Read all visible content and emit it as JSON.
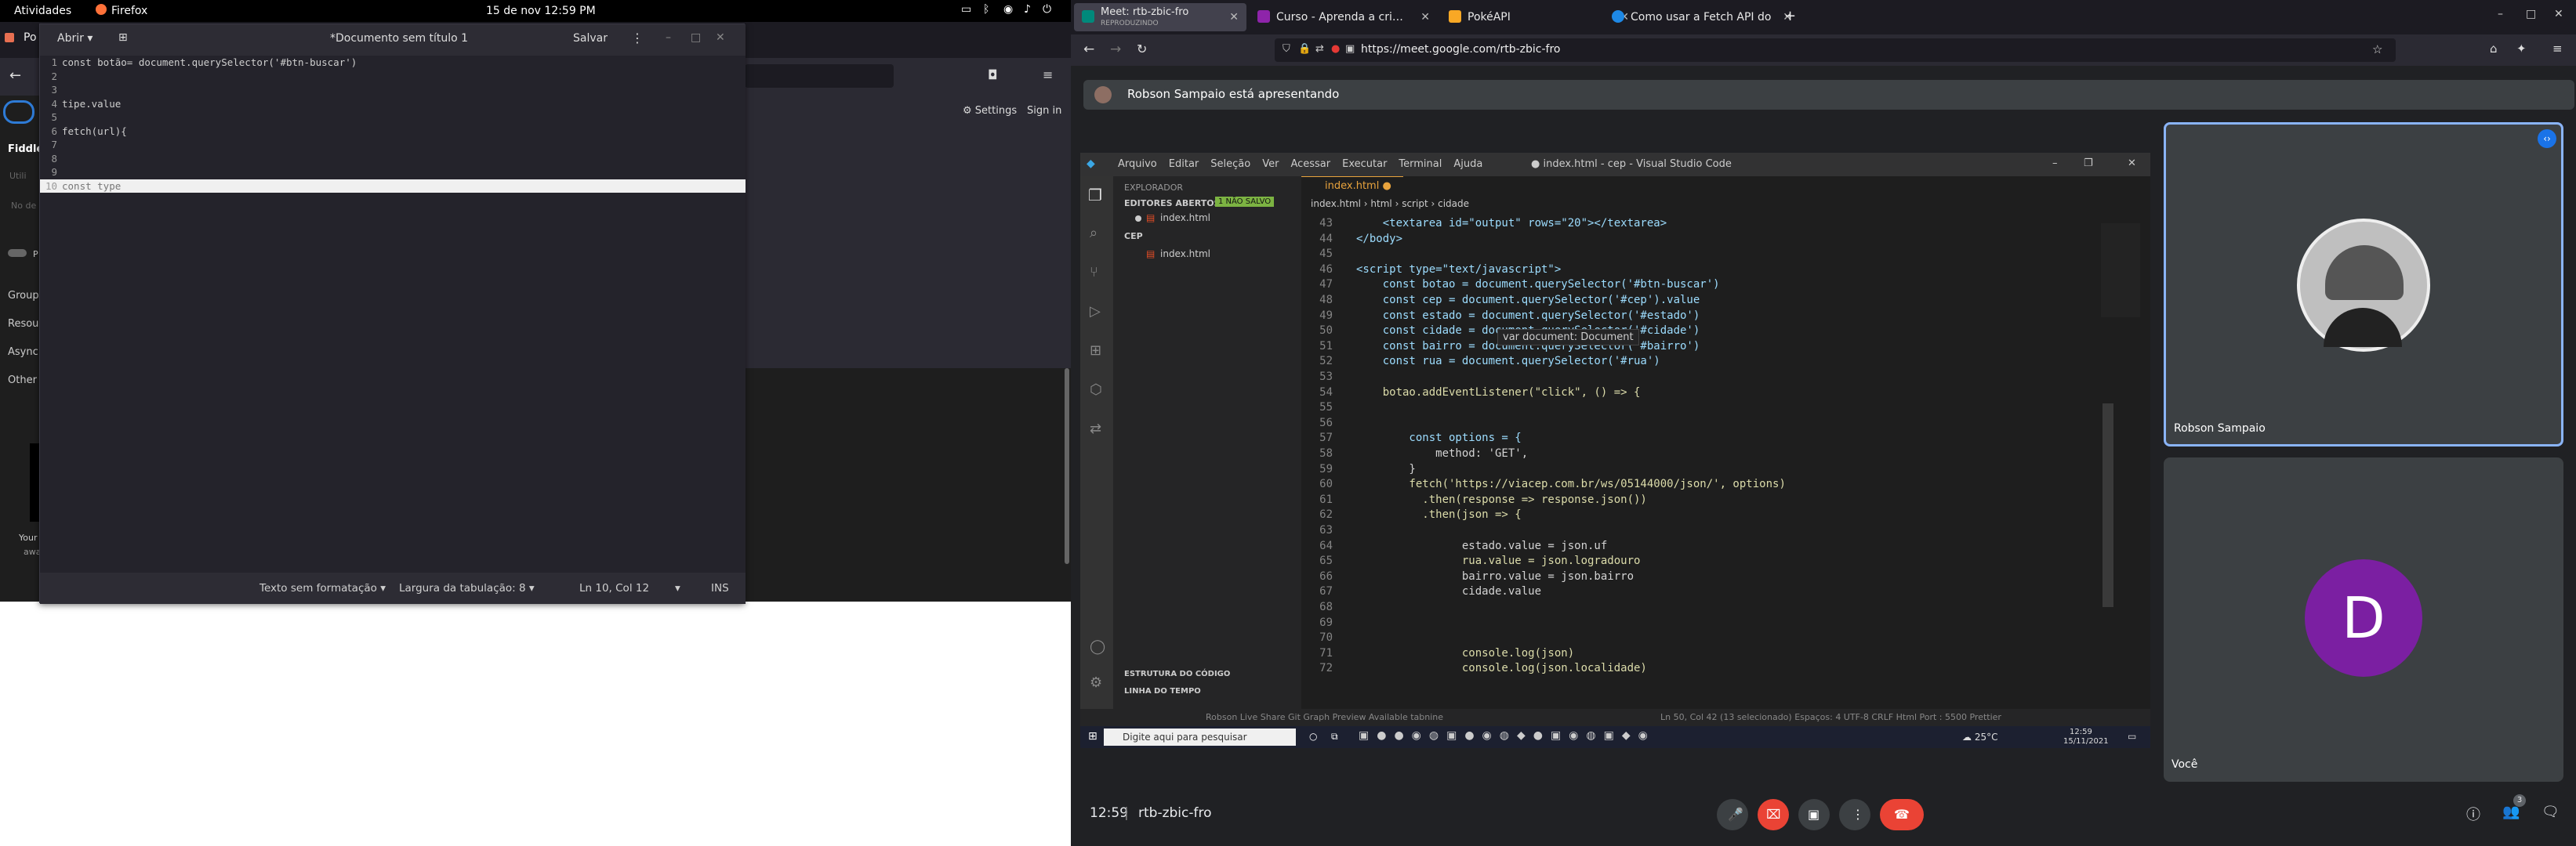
{
  "gnome": {
    "activities": "Atividades",
    "app": "Firefox",
    "datetime": "15 de nov  12:59 PM"
  },
  "bg_browser": {
    "tab": "Po",
    "settings": "Settings",
    "signin": "Sign in",
    "fiddle": "Fiddle",
    "items": [
      "Group",
      "Resou",
      "Async",
      "Other"
    ],
    "util": "Utili",
    "nao": "No de",
    "p": "P",
    "your": "Your",
    "awa": "awa"
  },
  "gedit": {
    "open_label": "Abrir",
    "title": "*Documento sem título 1",
    "save_label": "Salvar",
    "lines": [
      {
        "n": "1",
        "text": "const botão= document.querySelector('#btn-buscar')"
      },
      {
        "n": "2",
        "text": ""
      },
      {
        "n": "3",
        "text": ""
      },
      {
        "n": "4",
        "text": "tipe.value"
      },
      {
        "n": "5",
        "text": ""
      },
      {
        "n": "6",
        "text": "fetch(url){"
      },
      {
        "n": "7",
        "text": ""
      },
      {
        "n": "8",
        "text": ""
      },
      {
        "n": "9",
        "text": ""
      },
      {
        "n": "10",
        "text": "const type"
      }
    ],
    "status": {
      "format": "Texto sem formatação",
      "tab_width": "Largura da tabulação: 8",
      "position": "Ln 10, Col 12",
      "mode": "INS"
    }
  },
  "firefox": {
    "tabs": [
      {
        "label": "Meet: rtb-zbic-fro",
        "sub": "REPRODUZINDO",
        "color": "#00897b"
      },
      {
        "label": "Curso - Aprenda a criar u",
        "color": "#8e24aa"
      },
      {
        "label": "PokéAPI",
        "color": "#f9a825"
      },
      {
        "label": "Como usar a Fetch API do",
        "color": "#1e88e5"
      }
    ],
    "url": "https://meet.google.com/rtb-zbic-fro"
  },
  "meet": {
    "presenting": "Robson Sampaio está apresentando",
    "presenter_name": "Robson Sampaio",
    "you_label": "Você",
    "you_initial": "D",
    "you_color": "#7b1fa2",
    "time": "12:59",
    "code": "rtb-zbic-fro",
    "participants_count": "3"
  },
  "vscode": {
    "menu": [
      "Arquivo",
      "Editar",
      "Seleção",
      "Ver",
      "Acessar",
      "Executar",
      "Terminal",
      "Ajuda"
    ],
    "title": "● index.html - cep - Visual Studio Code",
    "explorer": "EXPLORADOR",
    "open_editors": "EDITORES ABERTOS",
    "unsaved": "1 NÃO SALVO",
    "file": "index.html",
    "folder": "CEP",
    "outline": "ESTRUTURA DO CÓDIGO",
    "timeline": "LINHA DO TEMPO",
    "tab": "index.html",
    "breadcrumb": [
      "index.html",
      "html",
      "script",
      "cidade"
    ],
    "tooltip": "var document: Document",
    "code": [
      {
        "n": "43",
        "t": "    <textarea id=\"output\" rows=\"20\"></textarea>"
      },
      {
        "n": "44",
        "t": "</body>"
      },
      {
        "n": "45",
        "t": ""
      },
      {
        "n": "46",
        "t": "<script type=\"text/javascript\">"
      },
      {
        "n": "47",
        "t": "    const botao = document.querySelector('#btn-buscar')"
      },
      {
        "n": "48",
        "t": "    const cep = document.querySelector('#cep').value"
      },
      {
        "n": "49",
        "t": "    const estado = document.querySelector('#estado')"
      },
      {
        "n": "50",
        "t": "    const cidade = document.querySelector('#cidade')"
      },
      {
        "n": "51",
        "t": "    const bairro = document.querySelector('#bairro')"
      },
      {
        "n": "52",
        "t": "    const rua = document.querySelector('#rua')"
      },
      {
        "n": "53",
        "t": ""
      },
      {
        "n": "54",
        "t": "    botao.addEventListener(\"click\", () => {"
      },
      {
        "n": "55",
        "t": ""
      },
      {
        "n": "56",
        "t": ""
      },
      {
        "n": "57",
        "t": "        const options = {"
      },
      {
        "n": "58",
        "t": "            method: 'GET',"
      },
      {
        "n": "59",
        "t": "        }"
      },
      {
        "n": "60",
        "t": "        fetch('https://viacep.com.br/ws/05144000/json/', options)"
      },
      {
        "n": "61",
        "t": "          .then(response => response.json())"
      },
      {
        "n": "62",
        "t": "          .then(json => {"
      },
      {
        "n": "63",
        "t": ""
      },
      {
        "n": "64",
        "t": "                estado.value = json.uf"
      },
      {
        "n": "65",
        "t": "                rua.value = json.logradouro"
      },
      {
        "n": "66",
        "t": "                bairro.value = json.bairro"
      },
      {
        "n": "67",
        "t": "                cidade.value"
      },
      {
        "n": "68",
        "t": ""
      },
      {
        "n": "69",
        "t": ""
      },
      {
        "n": "70",
        "t": ""
      },
      {
        "n": "71",
        "t": "                console.log(json)"
      },
      {
        "n": "72",
        "t": "                console.log(json.localidade)"
      }
    ],
    "status": "Ln 50, Col 42 (13 selecionado)   Espaços: 4   UTF-8   CRLF   Html   Port : 5500   Prettier",
    "status_left": "Robson   Live Share   Git Graph   Preview Available   tabnine",
    "taskbar_search": "Digite aqui para pesquisar",
    "temp": "25°C",
    "clock": "12:59",
    "date": "15/11/2021"
  }
}
